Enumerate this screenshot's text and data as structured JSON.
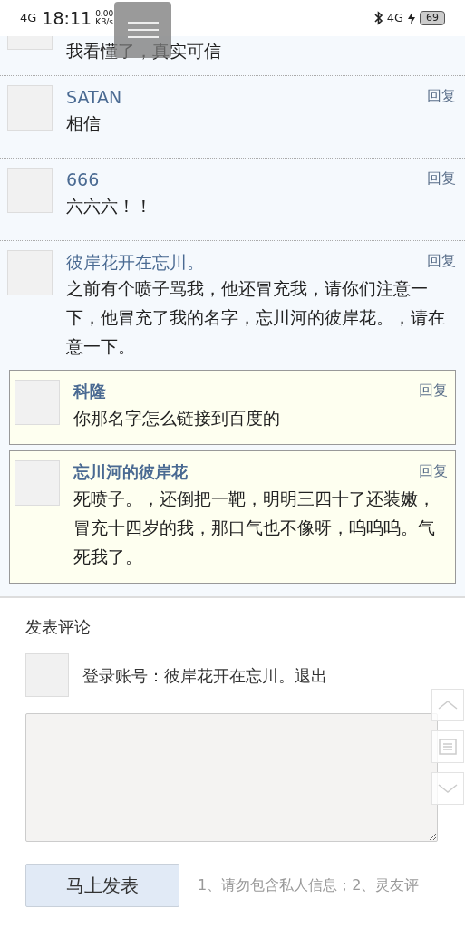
{
  "status_bar": {
    "network_left": "4G",
    "time": "18:11",
    "speed": "0.00",
    "speed_unit": "KB/s",
    "network_right": "4G",
    "battery": "69"
  },
  "comments": [
    {
      "kind": "partial",
      "text": "我看懂了，真实可信"
    },
    {
      "kind": "full",
      "name": "SATAN",
      "reply": "回复",
      "text": "相信"
    },
    {
      "kind": "full",
      "name": "666",
      "reply": "回复",
      "text": "六六六！！"
    },
    {
      "kind": "full",
      "name": "彼岸花开在忘川。",
      "reply": "回复",
      "text": "之前有个喷子骂我，他还冒充我，请你们注意一下，他冒充了我的名字，忘川河的彼岸花。，请在意一下。",
      "children": [
        {
          "name": "科隆",
          "reply": "回复",
          "text": "你那名字怎么链接到百度的"
        },
        {
          "name": "忘川河的彼岸花",
          "reply": "回复",
          "text": "死喷子。，还倒把一靶，明明三四十了还装嫩，冒充十四岁的我，那口气也不像呀，呜呜呜。气死我了。"
        }
      ]
    }
  ],
  "compose": {
    "title": "发表评论",
    "login_label": "登录账号：",
    "account": "彼岸花开在忘川。",
    "logout": "退出",
    "submit": "马上发表",
    "hint": "1、请勿包含私人信息；2、灵友评"
  }
}
